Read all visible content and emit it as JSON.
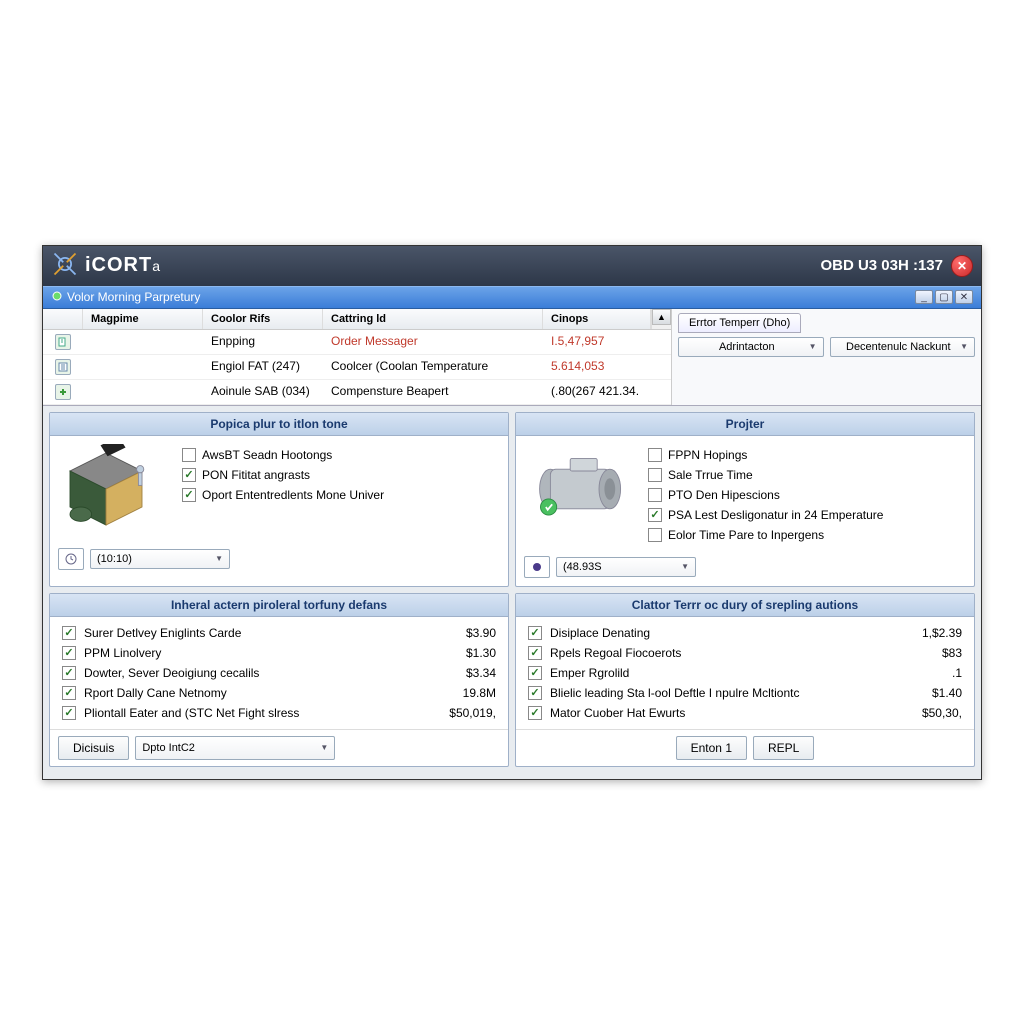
{
  "titlebar": {
    "app_name_main": "iCORT",
    "app_name_suffix": "a",
    "status": "OBD U3 03H :137"
  },
  "subwindow": {
    "title": "Volor Morning Parpretury"
  },
  "table": {
    "headers": {
      "a": "Magpime",
      "b": "Coolor Rifs",
      "c": "Cattring ld",
      "d": "Cinops"
    },
    "rows": [
      {
        "icon": "doc",
        "a": "",
        "b": "Enpping",
        "c": "Order Messager",
        "c_red": true,
        "d": "I.5,47,957"
      },
      {
        "icon": "list",
        "a": "",
        "b": "Engiol FAT (247)",
        "c": "Coolcer (Coolan Temperature",
        "c_red": false,
        "d": "5.614,053"
      },
      {
        "icon": "plus",
        "a": "",
        "b": "Aoinule SAB (034)",
        "c": "Compensture Beapert",
        "c_red": false,
        "d": "(.80(267 421.34."
      }
    ]
  },
  "side": {
    "tab": "Errtor Temperr (Dho)",
    "dd1": "Adrintacton",
    "dd2": "Decentenulc Nackunt"
  },
  "panel_tl": {
    "title": "Popica plur to itlon tone",
    "checks": [
      {
        "label": "AwsBT Seadn Hootongs",
        "checked": false
      },
      {
        "label": "PON Fititat angrasts",
        "checked": true
      },
      {
        "label": "Oport Ententredlents Mone Univer",
        "checked": true
      }
    ],
    "dd": "(10:10)"
  },
  "panel_tr": {
    "title": "Projter",
    "checks": [
      {
        "label": "FPPN Hopings",
        "checked": false
      },
      {
        "label": "Sale Trrue Time",
        "checked": false
      },
      {
        "label": "PTO Den Hipescions",
        "checked": false
      },
      {
        "label": "PSA Lest Desligonatur in 24 Emperature",
        "checked": true
      },
      {
        "label": "Eolor Time Pare to Inpergens",
        "checked": false
      }
    ],
    "dd": "(48.93S"
  },
  "panel_bl": {
    "title": "Inheral actern piroleral torfuny defans",
    "rows": [
      {
        "label": "Surer Detlvey Eniglints Carde",
        "value": "$3.90",
        "checked": true
      },
      {
        "label": "PPM Linolvery",
        "value": "$1.30",
        "checked": true
      },
      {
        "label": "Dowter, Sever Deoigiung cecalils",
        "value": "$3.34",
        "checked": true
      },
      {
        "label": "Rport Dally Cane Netnomy",
        "value": "19.8M",
        "checked": true
      },
      {
        "label": "Pliontall Eater and (STC Net Fight slress",
        "value": "$50,019,",
        "checked": true
      }
    ],
    "btn1": "Dicisuis",
    "btn2": "Dpto IntC2"
  },
  "panel_br": {
    "title": "Clattor Terrr oc dury of srepling autions",
    "rows": [
      {
        "label": "Disiplace Denating",
        "value": "1,$2.39",
        "checked": true
      },
      {
        "label": "Rpels Regoal Fiocoerots",
        "value": "$83",
        "checked": true
      },
      {
        "label": "Emper Rgrolild",
        "value": ".1",
        "checked": true
      },
      {
        "label": "Blielic leading Sta l-ool Deftle I npulre Mcltiontc",
        "value": "$1.40",
        "checked": true
      },
      {
        "label": "Mator Cuober Hat Ewurts",
        "value": "$50,30,",
        "checked": true
      }
    ],
    "btn1": "Enton 1",
    "btn2": "REPL"
  }
}
